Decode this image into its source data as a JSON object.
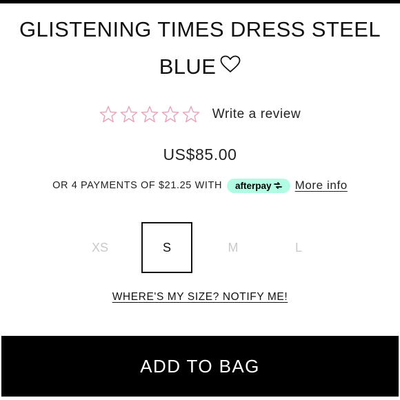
{
  "product": {
    "title": "GLISTENING TIMES DRESS STEEL BLUE",
    "wishlist_icon": "heart-outline-icon",
    "price": "US$85.00"
  },
  "rating": {
    "stars_filled": 0,
    "stars_total": 5,
    "star_color": "#e9a0bb",
    "review_link": "Write a review"
  },
  "installments": {
    "text": "OR 4 PAYMENTS OF $21.25 WITH",
    "provider": "afterpay",
    "provider_badge_color": "#b2fce4",
    "more_info": "More info"
  },
  "sizes": {
    "options": [
      "XS",
      "S",
      "M",
      "L"
    ],
    "selected": "S"
  },
  "notify_link": "WHERE'S MY SIZE? NOTIFY ME!",
  "add_to_bag": "ADD TO BAG"
}
